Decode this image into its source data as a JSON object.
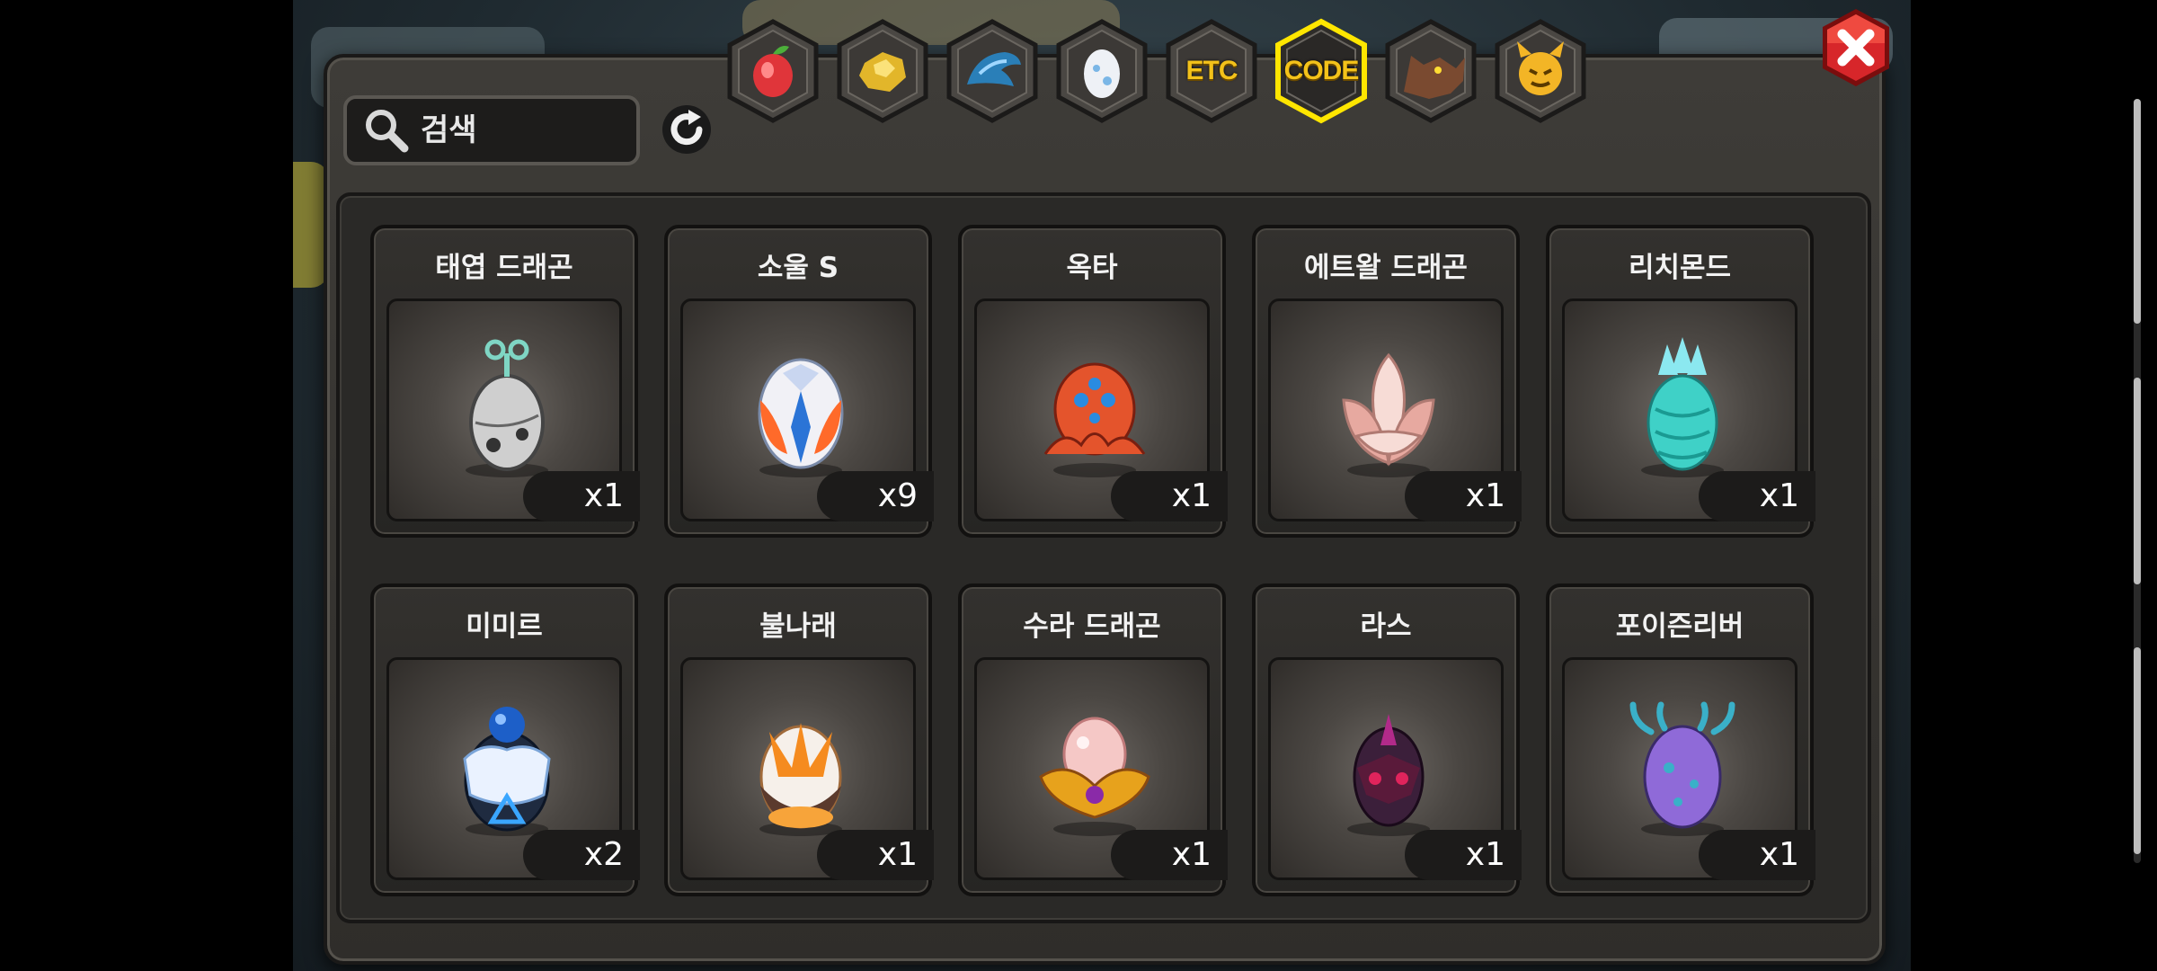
{
  "search": {
    "placeholder": "검색"
  },
  "tabs": [
    {
      "name": "fruit",
      "icon": "fruit-icon",
      "label": "",
      "selected": false
    },
    {
      "name": "gold",
      "icon": "gold-nugget-icon",
      "label": "",
      "selected": false
    },
    {
      "name": "dragon",
      "icon": "dragon-head-icon",
      "label": "",
      "selected": false
    },
    {
      "name": "egg",
      "icon": "egg-icon",
      "label": "",
      "selected": false
    },
    {
      "name": "etc",
      "icon": "",
      "label": "ETC",
      "selected": false
    },
    {
      "name": "code",
      "icon": "",
      "label": "CODE",
      "selected": true
    },
    {
      "name": "wolf",
      "icon": "wolf-icon",
      "label": "",
      "selected": false
    },
    {
      "name": "monster",
      "icon": "monster-icon",
      "label": "",
      "selected": false
    }
  ],
  "items": [
    {
      "name": "태엽 드래곤",
      "count": "x1",
      "icon": "clockwork-egg-icon",
      "colors": [
        "#cfcfcf",
        "#7fd6c4"
      ]
    },
    {
      "name": "소울 S",
      "count": "x9",
      "icon": "soul-egg-icon",
      "colors": [
        "#f1f1f6",
        "#ff6a2a"
      ]
    },
    {
      "name": "옥타",
      "count": "x1",
      "icon": "octopus-egg-icon",
      "colors": [
        "#e4542c",
        "#2a8be0"
      ]
    },
    {
      "name": "에트왈 드래곤",
      "count": "x1",
      "icon": "lotus-egg-icon",
      "colors": [
        "#f7dcd6",
        "#e7a9a0"
      ]
    },
    {
      "name": "리치몬드",
      "count": "x1",
      "icon": "crystal-egg-icon",
      "colors": [
        "#3fd1c7",
        "#8be8f0"
      ]
    },
    {
      "name": "미미르",
      "count": "x2",
      "icon": "rune-egg-icon",
      "colors": [
        "#1d5fc8",
        "#eaf2ff"
      ]
    },
    {
      "name": "불나래",
      "count": "x1",
      "icon": "flame-egg-icon",
      "colors": [
        "#f58b1f",
        "#5b3a2d"
      ]
    },
    {
      "name": "수라 드래곤",
      "count": "x1",
      "icon": "pearl-egg-icon",
      "colors": [
        "#f5c8c6",
        "#e7a21c"
      ]
    },
    {
      "name": "라스",
      "count": "x1",
      "icon": "dark-egg-icon",
      "colors": [
        "#3b1f3a",
        "#e0245c"
      ]
    },
    {
      "name": "포이즌리버",
      "count": "x1",
      "icon": "poison-egg-icon",
      "colors": [
        "#8f6ad8",
        "#3ab0c8"
      ]
    }
  ]
}
